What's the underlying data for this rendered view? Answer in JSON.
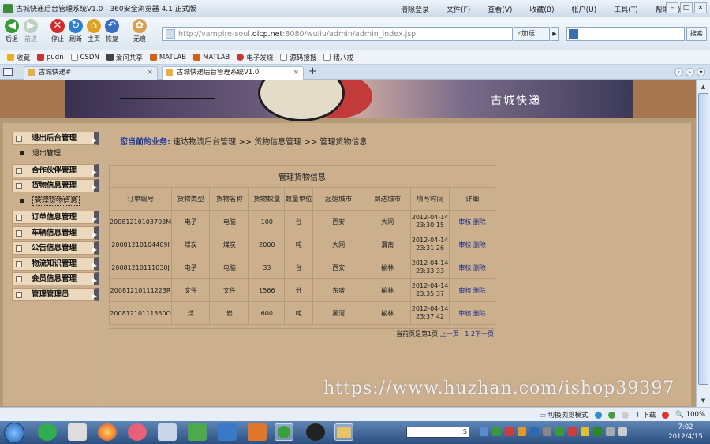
{
  "browser": {
    "window_title": "古城快递后台管理系统V1.0 - 360安全浏览器 4.1 正式版",
    "menus": [
      "清除登录",
      "文件(F)",
      "查看(V)",
      "收藏(B)",
      "帐户(U)",
      "工具(T)",
      "帮助(H)"
    ],
    "nav_buttons": [
      "后退",
      "前进",
      "停止",
      "刷新",
      "主页",
      "恢复",
      "无痕"
    ],
    "url_prefix": "http://vampire-soul.",
    "url_host": "oicp.net",
    "url_rest": ":8080/wuliu/admin/admin_index.jsp",
    "speed_button": "加速",
    "search_button": "搜索",
    "favorites": [
      "收藏",
      "pudn",
      "CSDN",
      "爱问共享",
      "MATLAB",
      "MATLAB",
      "电子发烧",
      "源码搜搜",
      "猪八戒"
    ],
    "tabs": [
      {
        "label": "古城快递#"
      },
      {
        "label": "古城快递后台管理系统V1.0"
      }
    ],
    "new_tab": "+"
  },
  "site": {
    "brand": "古城快递"
  },
  "sidebar": {
    "items": [
      {
        "label": "退出后台管理",
        "sub": [
          "退出管理"
        ]
      },
      {
        "label": "合作伙伴管理",
        "sub": []
      },
      {
        "label": "货物信息管理",
        "sub": [
          "管理货物信息"
        ]
      },
      {
        "label": "订单信息管理",
        "sub": []
      },
      {
        "label": "车辆信息管理",
        "sub": []
      },
      {
        "label": "公告信息管理",
        "sub": []
      },
      {
        "label": "物流知识管理",
        "sub": []
      },
      {
        "label": "会员信息管理",
        "sub": []
      },
      {
        "label": "管理管理员",
        "sub": []
      }
    ]
  },
  "breadcrumb": {
    "title": "您当前的业务:",
    "path": " 速达物流后台管理 >> 货物信息管理 >> 管理货物信息"
  },
  "table": {
    "caption": "管理货物信息",
    "columns": [
      "订单编号",
      "货物类型",
      "货物名称",
      "货物数量",
      "数量单位",
      "起始城市",
      "到达城市",
      "填写时间",
      "详细"
    ],
    "rows": [
      {
        "id": "20081210103703M",
        "type": "电子",
        "name": "电脑",
        "qty": "100",
        "unit": "台",
        "from": "西安",
        "to": "大同",
        "date": "2012-04-14",
        "time": "23:30:15"
      },
      {
        "id": "20081210104409I",
        "type": "煤炭",
        "name": "煤炭",
        "qty": "2000",
        "unit": "吨",
        "from": "大同",
        "to": "渭南",
        "date": "2012-04-14",
        "time": "23:31:26"
      },
      {
        "id": "20081210111030J",
        "type": "电子",
        "name": "电脑",
        "qty": "33",
        "unit": "台",
        "from": "西安",
        "to": "榆林",
        "date": "2012-04-14",
        "time": "23:33:33"
      },
      {
        "id": "20081210111223R",
        "type": "文件",
        "name": "文件",
        "qty": "1566",
        "unit": "分",
        "from": "东盛",
        "to": "榆林",
        "date": "2012-04-14",
        "time": "23:35:37"
      },
      {
        "id": "20081210111350O",
        "type": "煤",
        "name": "炭",
        "qty": "600",
        "unit": "吨",
        "from": "黑河",
        "to": "榆林",
        "date": "2012-04-14",
        "time": "23:37:42"
      }
    ],
    "action_review": "审核",
    "action_delete": "删除"
  },
  "pager": {
    "text": "当前页是第1页",
    "prev": "上一页",
    "page1": "1",
    "page2": "2",
    "next": "下一页"
  },
  "watermark": "https://www.huzhan.com/ishop39397",
  "statusbar": {
    "mode": "切换浏览模式",
    "download": "下载",
    "zoom": "100%"
  },
  "taskbar": {
    "input_value": "S",
    "time": "7:02",
    "date": "2012/4/15"
  }
}
